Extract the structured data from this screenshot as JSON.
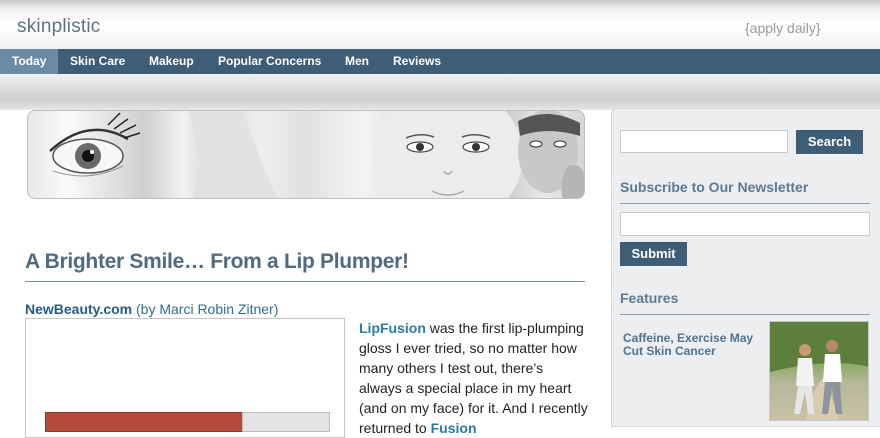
{
  "header": {
    "logo": "skinplistic",
    "tagline": "{apply daily}"
  },
  "nav": {
    "items": [
      {
        "label": "Today",
        "active": true
      },
      {
        "label": "Skin Care",
        "active": false
      },
      {
        "label": "Makeup",
        "active": false
      },
      {
        "label": "Popular Concerns",
        "active": false
      },
      {
        "label": "Men",
        "active": false
      },
      {
        "label": "Reviews",
        "active": false
      }
    ]
  },
  "article": {
    "title": "A Brighter Smile… From a Lip Plumper!",
    "byline_source": "NewBeauty.com",
    "byline_author": " (by Marci Robin Zitner)",
    "body_link": "LipFusion",
    "body_text": " was the first lip-plumping gloss I ever tried, so no matter how many others I test out, there’s always a special place in my heart (and on my face) for it. And I recently returned to ",
    "body_link2": "Fusion"
  },
  "sidebar": {
    "search": {
      "placeholder": "",
      "button_label": "Search"
    },
    "newsletter": {
      "heading": "Subscribe to Our Newsletter",
      "placeholder": "",
      "button_label": "Submit"
    },
    "features": {
      "heading": "Features",
      "items": [
        {
          "title": "Caffeine, Exercise May Cut Skin Cancer"
        }
      ]
    }
  },
  "colors": {
    "nav_bg": "#3e5d76",
    "nav_active": "#6b8aa3",
    "heading": "#4f6b80",
    "link": "#2a7ca5"
  }
}
